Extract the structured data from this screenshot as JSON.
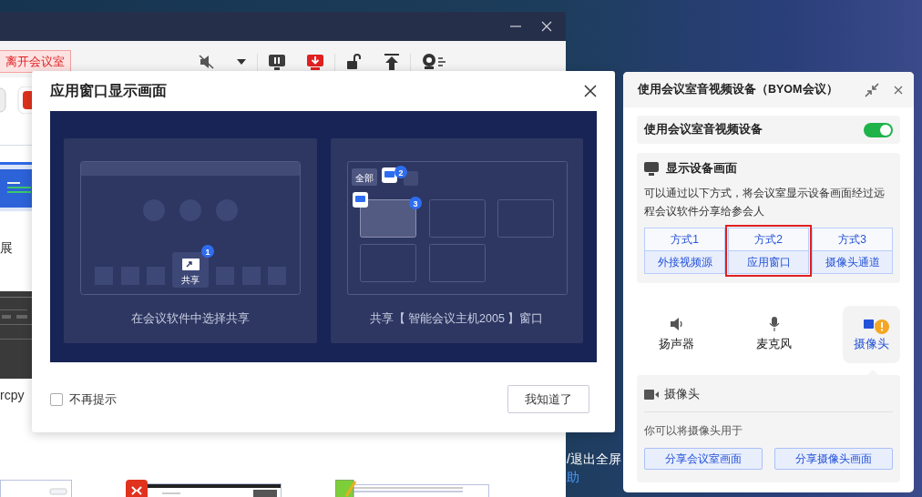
{
  "back_window": {
    "leave_button": "离开会议室",
    "thumbnail_labels": [
      "展",
      "rcpy"
    ]
  },
  "desktop_texts": [
    {
      "text": "/退出全屏",
      "kind": "plain"
    },
    {
      "text": "助",
      "kind": "link"
    }
  ],
  "dialog": {
    "title": "应用窗口显示画面",
    "illustration": {
      "left_caption": "在会议软件中选择共享",
      "share_label": "共享",
      "steps": [
        "1",
        "2",
        "3"
      ],
      "all_label": "全部",
      "right_caption": "共享【 智能会议主机2005 】窗口"
    },
    "dont_show_again": {
      "label": "不再提示",
      "checked": false
    },
    "confirm_button": "我知道了"
  },
  "panel": {
    "title": "使用会议室音视频设备（BYOM会议）",
    "device_toggle": {
      "label": "使用会议室音视频设备",
      "on": true
    },
    "display": {
      "title": "显示设备画面",
      "description": "可以通过以下方式，将会议室显示设备画面经过远程会议软件分享给参会人",
      "options": [
        {
          "method": "方式1",
          "name": "外接视频源",
          "selected": false
        },
        {
          "method": "方式2",
          "name": "应用窗口",
          "selected": true
        },
        {
          "method": "方式3",
          "name": "摄像头通道",
          "selected": false
        }
      ]
    },
    "devices": [
      {
        "kind": "speaker",
        "label": "扬声器",
        "selected": false,
        "warning": false
      },
      {
        "kind": "microphone",
        "label": "麦克风",
        "selected": false,
        "warning": false
      },
      {
        "kind": "camera",
        "label": "摄像头",
        "selected": true,
        "warning": true
      }
    ],
    "camera": {
      "title": "摄像头",
      "hint": "你可以将摄像头用于",
      "buttons": [
        "分享会议室画面",
        "分享摄像头画面"
      ]
    }
  }
}
